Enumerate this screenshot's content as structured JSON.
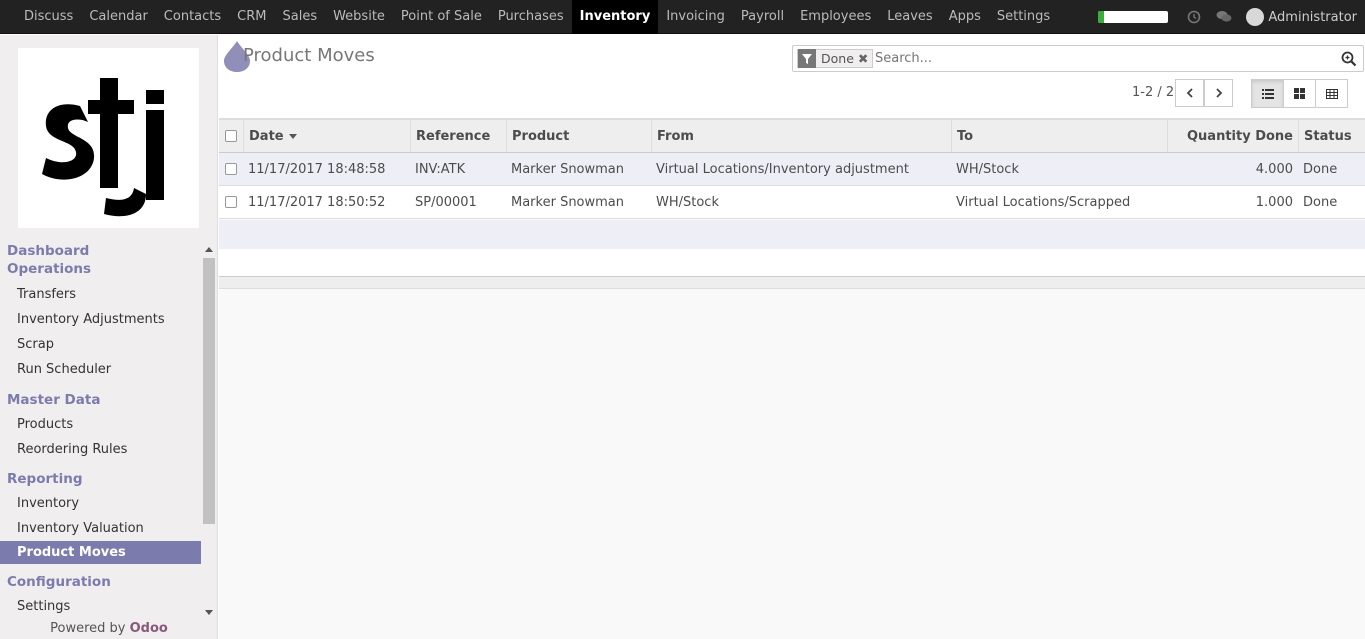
{
  "topbar": {
    "apps": [
      "Discuss",
      "Calendar",
      "Contacts",
      "CRM",
      "Sales",
      "Website",
      "Point of Sale",
      "Purchases",
      "Inventory",
      "Invoicing",
      "Payroll",
      "Employees",
      "Leaves",
      "Apps",
      "Settings"
    ],
    "active_app": "Inventory",
    "onboarding_progress": 0.08,
    "icons": [
      "clock-icon",
      "chat-icon"
    ],
    "user_name": "Administrator"
  },
  "sidebar": {
    "logo_text": "stj",
    "sections": [
      {
        "title": "Dashboard",
        "items": []
      },
      {
        "title": "Operations",
        "items": [
          "Transfers",
          "Inventory Adjustments",
          "Scrap",
          "Run Scheduler"
        ]
      },
      {
        "title": "Master Data",
        "items": [
          "Products",
          "Reordering Rules"
        ]
      },
      {
        "title": "Reporting",
        "items": [
          "Inventory",
          "Inventory Valuation",
          "Product Moves"
        ]
      },
      {
        "title": "Configuration",
        "items": [
          "Settings"
        ]
      }
    ],
    "active_item": "Product Moves",
    "powered_prefix": "Powered by",
    "powered_brand": "Odoo"
  },
  "control_panel": {
    "title": "Product Moves",
    "search": {
      "facet": "Done",
      "placeholder": "Search..."
    },
    "pager": "1-2 / 2",
    "views": [
      "list-view-icon",
      "kanban-view-icon",
      "pivot-view-icon"
    ],
    "active_view": "list-view-icon"
  },
  "table": {
    "columns": [
      "Date",
      "Reference",
      "Product",
      "From",
      "To",
      "Quantity Done",
      "Status"
    ],
    "sorted_column": "Date",
    "rows": [
      {
        "date": "11/17/2017 18:48:58",
        "reference": "INV:ATK",
        "product": "Marker Snowman",
        "from": "Virtual Locations/Inventory adjustment",
        "to": "WH/Stock",
        "qty": "4.000",
        "status": "Done"
      },
      {
        "date": "11/17/2017 18:50:52",
        "reference": "SP/00001",
        "product": "Marker Snowman",
        "from": "WH/Stock",
        "to": "Virtual Locations/Scrapped",
        "qty": "1.000",
        "status": "Done"
      }
    ]
  },
  "colors": {
    "accent": "#7c7bad",
    "topbar": "#222222",
    "brand": "#875a7b"
  }
}
